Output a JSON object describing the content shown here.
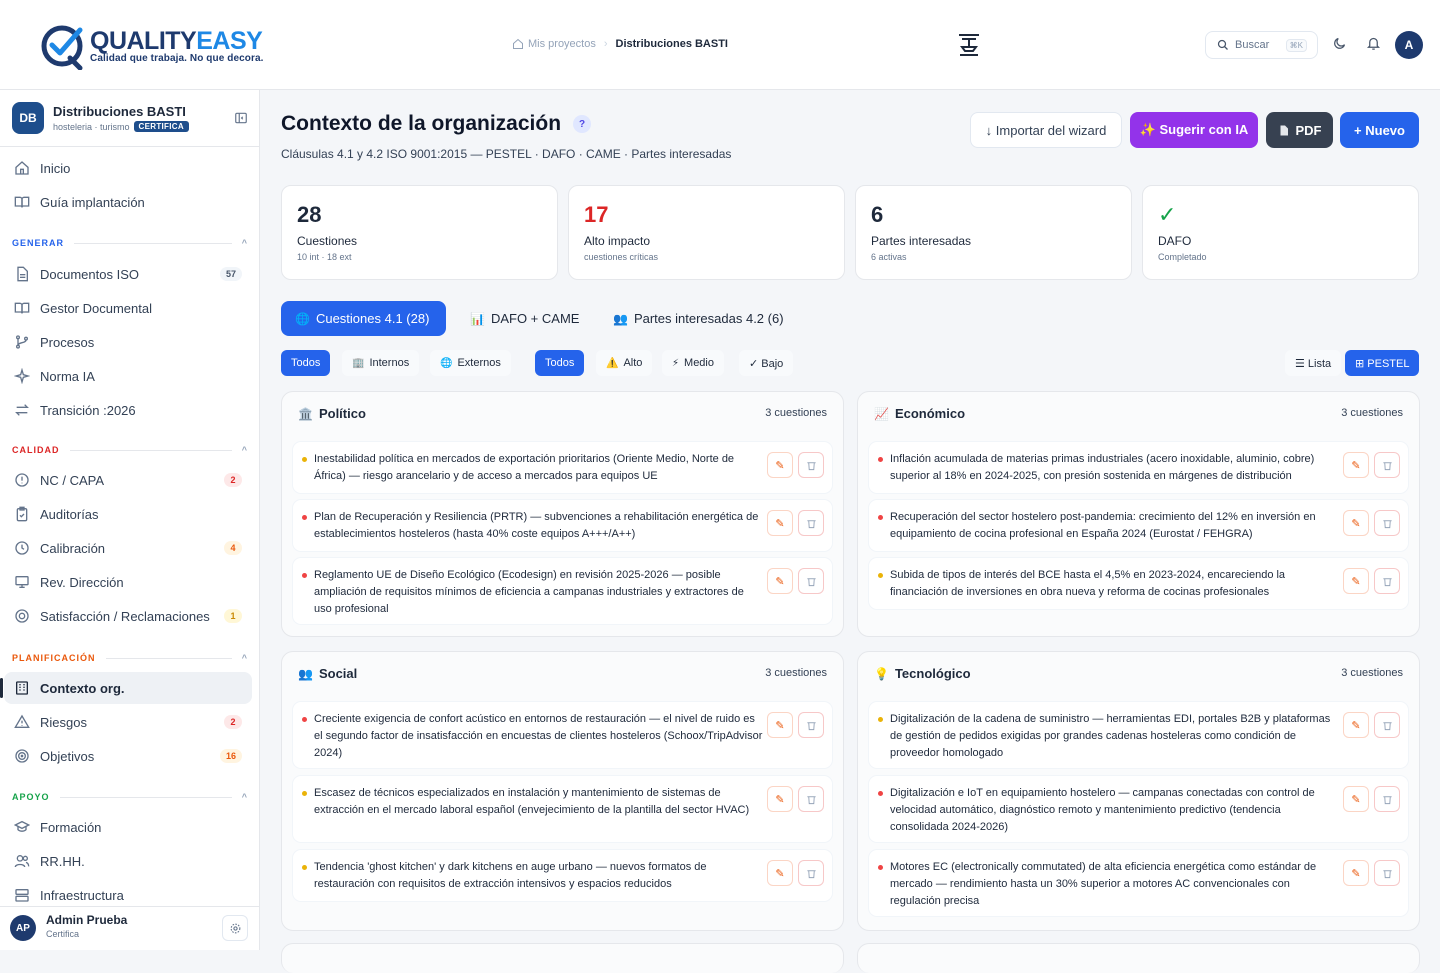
{
  "brand": {
    "name_a": "QUALITY",
    "name_b": "EASY",
    "tagline": "Calidad que trabaja. No que decora."
  },
  "breadcrumb": {
    "root": "Mis proyectos",
    "current": "Distribuciones BASTI"
  },
  "search": {
    "label": "Buscar",
    "shortcut": "⌘K"
  },
  "topbar": {
    "avatar": "A"
  },
  "org": {
    "initials": "DB",
    "name": "Distribuciones BASTI",
    "sector": "hosteleria · turismo",
    "status": "CERTIFICA"
  },
  "nav": {
    "top": [
      {
        "label": "Inicio"
      },
      {
        "label": "Guía implantación"
      }
    ],
    "generar": {
      "title": "GENERAR",
      "items": [
        {
          "label": "Documentos ISO",
          "badge": "57"
        },
        {
          "label": "Gestor Documental"
        },
        {
          "label": "Procesos"
        },
        {
          "label": "Norma IA"
        },
        {
          "label": "Transición :2026"
        }
      ]
    },
    "calidad": {
      "title": "CALIDAD",
      "items": [
        {
          "label": "NC / CAPA",
          "badge": "2"
        },
        {
          "label": "Auditorías"
        },
        {
          "label": "Calibración",
          "badge": "4"
        },
        {
          "label": "Rev. Dirección"
        },
        {
          "label": "Satisfacción / Reclamaciones",
          "badge": "1"
        }
      ]
    },
    "planificacion": {
      "title": "PLANIFICACIÓN",
      "items": [
        {
          "label": "Contexto org."
        },
        {
          "label": "Riesgos",
          "badge": "2"
        },
        {
          "label": "Objetivos",
          "badge": "16"
        }
      ]
    },
    "apoyo": {
      "title": "APOYO",
      "items": [
        {
          "label": "Formación"
        },
        {
          "label": "RR.HH."
        },
        {
          "label": "Infraestructura"
        }
      ]
    }
  },
  "user": {
    "initials": "AP",
    "name": "Admin Prueba",
    "role": "Certifica"
  },
  "page": {
    "title": "Contexto de la organización",
    "help": "?",
    "subtitle": "Cláusulas 4.1 y 4.2 ISO 9001:2015 — PESTEL · DAFO · CAME · Partes interesadas",
    "buttons": {
      "import": "↓ Importar del wizard",
      "ia": "✨ Sugerir con IA",
      "pdf": "PDF",
      "new": "+ Nuevo"
    }
  },
  "stats": [
    {
      "value": "28",
      "label": "Cuestiones",
      "sub": "10 int · 18 ext",
      "color": "#0f172a"
    },
    {
      "value": "17",
      "label": "Alto impacto",
      "sub": "cuestiones críticas",
      "color": "#dc2626"
    },
    {
      "value": "6",
      "label": "Partes interesadas",
      "sub": "6 activas",
      "color": "#0f172a"
    },
    {
      "value": "✓",
      "label": "DAFO",
      "sub": "Completado",
      "color": "#16a34a"
    }
  ],
  "tabs": [
    {
      "icon": "🌐",
      "label": "Cuestiones 4.1 (28)"
    },
    {
      "icon": "📊",
      "label": "DAFO + CAME"
    },
    {
      "icon": "👥",
      "label": "Partes interesadas 4.2 (6)"
    }
  ],
  "filters": {
    "scope": [
      {
        "label": "Todos"
      },
      {
        "icon": "🏢",
        "label": "Internos"
      },
      {
        "icon": "🌐",
        "label": "Externos"
      }
    ],
    "impact": [
      {
        "label": "Todos"
      },
      {
        "icon": "⚠️",
        "label": "Alto"
      },
      {
        "icon": "⚡",
        "label": "Medio"
      },
      {
        "icon": "",
        "label": "✓ Bajo"
      }
    ],
    "view": [
      {
        "label": "☰ Lista"
      },
      {
        "label": "⊞ PESTEL"
      }
    ]
  },
  "colors": {
    "alto": "#ef4444",
    "medio": "#eab308",
    "primary": "#2563eb"
  },
  "pestel": [
    {
      "icon": "🏛️",
      "title": "Político",
      "count": "3 cuestiones",
      "items": [
        {
          "impact": "medio",
          "text": "Inestabilidad política en mercados de exportación prioritarios (Oriente Medio, Norte de África) — riesgo arancelario y de acceso a mercados para equipos UE"
        },
        {
          "impact": "alto",
          "text": "Plan de Recuperación y Resiliencia (PRTR) — subvenciones a rehabilitación energética de establecimientos hosteleros (hasta 40% coste equipos A+++/A++)"
        },
        {
          "impact": "alto",
          "text": "Reglamento UE de Diseño Ecológico (Ecodesign) en revisión 2025-2026 — posible ampliación de requisitos mínimos de eficiencia a campanas industriales y extractores de uso profesional"
        }
      ]
    },
    {
      "icon": "📈",
      "title": "Económico",
      "count": "3 cuestiones",
      "items": [
        {
          "impact": "alto",
          "text": "Inflación acumulada de materias primas industriales (acero inoxidable, aluminio, cobre) superior al 18% en 2024-2025, con presión sostenida en márgenes de distribución"
        },
        {
          "impact": "alto",
          "text": "Recuperación del sector hostelero post-pandemia: crecimiento del 12% en inversión en equipamiento de cocina profesional en España 2024 (Eurostat / FEHGRA)"
        },
        {
          "impact": "medio",
          "text": "Subida de tipos de interés del BCE hasta el 4,5% en 2023-2024, encareciendo la financiación de inversiones en obra nueva y reforma de cocinas profesionales"
        }
      ]
    },
    {
      "icon": "👥",
      "title": "Social",
      "count": "3 cuestiones",
      "items": [
        {
          "impact": "alto",
          "text": "Creciente exigencia de confort acústico en entornos de restauración — el nivel de ruido es el segundo factor de insatisfacción en encuestas de clientes hosteleros (Schoox/TripAdvisor 2024)"
        },
        {
          "impact": "medio",
          "text": "Escasez de técnicos especializados en instalación y mantenimiento de sistemas de extracción en el mercado laboral español (envejecimiento de la plantilla del sector HVAC)"
        },
        {
          "impact": "medio",
          "text": "Tendencia 'ghost kitchen' y dark kitchens en auge urbano — nuevos formatos de restauración con requisitos de extracción intensivos y espacios reducidos"
        }
      ]
    },
    {
      "icon": "💡",
      "title": "Tecnológico",
      "count": "3 cuestiones",
      "items": [
        {
          "impact": "medio",
          "text": "Digitalización de la cadena de suministro — herramientas EDI, portales B2B y plataformas de gestión de pedidos exigidas por grandes cadenas hosteleras como condición de proveedor homologado"
        },
        {
          "impact": "alto",
          "text": "Digitalización e IoT en equipamiento hostelero — campanas conectadas con control de velocidad automático, diagnóstico remoto y mantenimiento predictivo (tendencia consolidada 2024-2026)"
        },
        {
          "impact": "alto",
          "text": "Motores EC (electronically commutated) de alta eficiencia energética como estándar de mercado — rendimiento hasta un 30% superior a motores AC convencionales con regulación precisa"
        }
      ]
    }
  ]
}
